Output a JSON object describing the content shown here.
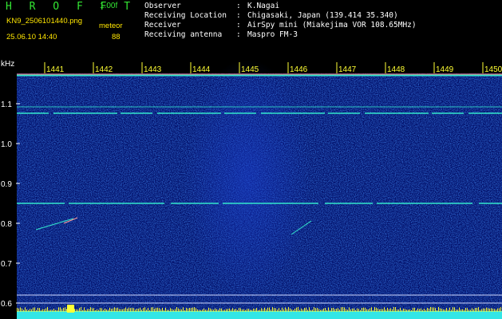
{
  "header": {
    "brand": "H R O F F T",
    "version": "1.00f",
    "filename": "KN9_2506101440.png",
    "datetime": "25.06.10 14:40",
    "meteor_label": "meteor",
    "meteor_count": "88",
    "info": [
      {
        "key": "Observer",
        "sep": ":",
        "value": "K.Nagai"
      },
      {
        "key": "Receiving Location",
        "sep": ":",
        "value": "Chigasaki, Japan (139.414 35.340)"
      },
      {
        "key": "Receiver",
        "sep": ":",
        "value": "AirSpy mini (Miakejima VOR 108.65MHz)"
      },
      {
        "key": "Receiving antenna",
        "sep": ":",
        "value": "Maspro FM-3"
      }
    ]
  },
  "spectrogram": {
    "y_unit": "kHz",
    "y_ticks": [
      "1.1",
      "1.0",
      "0.9",
      "0.8",
      "0.7",
      "0.6"
    ],
    "x_ticks": [
      "1441",
      "1442",
      "1443",
      "1444",
      "1445",
      "1446",
      "1447",
      "1448",
      "1449",
      "1450"
    ],
    "colors": {
      "background": "#000c66",
      "signal": "#33e6cc",
      "bright": "#ffff33",
      "axis": "#ffffff"
    }
  }
}
